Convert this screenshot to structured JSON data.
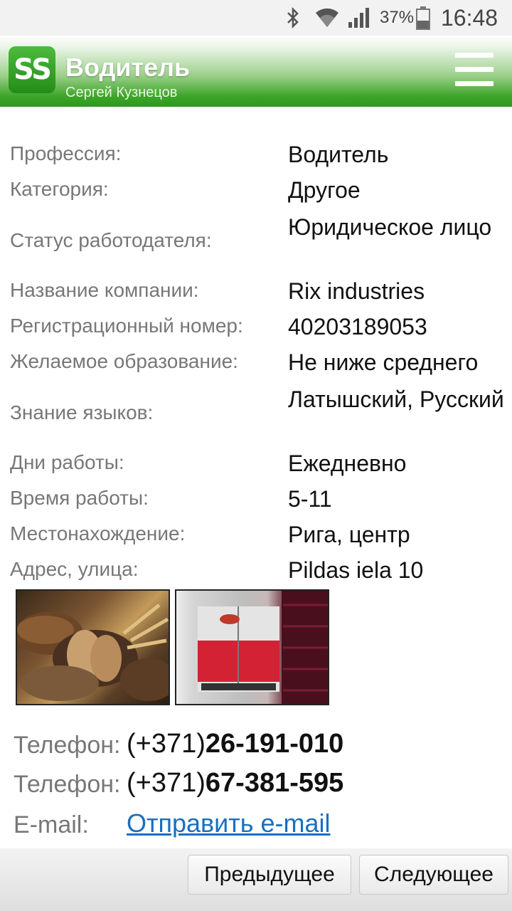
{
  "status_bar": {
    "battery_percent": "37%",
    "time": "16:48",
    "icons": [
      "bluetooth-icon",
      "wifi-icon",
      "signal-icon",
      "battery-icon"
    ]
  },
  "header": {
    "logo_text": "SS",
    "title": "Водитель",
    "subtitle": "Сергей Кузнецов",
    "menu_icon": "hamburger-menu-icon"
  },
  "details": [
    {
      "label": "Профессия:",
      "value": "Водитель"
    },
    {
      "label": "Категория:",
      "value": "Другое"
    },
    {
      "label": "Статус работодателя:",
      "value": "Юридическое лицо"
    },
    {
      "label": "Название компании:",
      "value": "Rix industries"
    },
    {
      "label": "Регистрационный номер:",
      "value": "40203189053"
    },
    {
      "label": "Желаемое образование:",
      "value": "Не ниже среднего"
    },
    {
      "label": "Знание языков:",
      "value": "Латышский, Русский"
    },
    {
      "label": "Дни работы:",
      "value": "Ежедневно"
    },
    {
      "label": "Время работы:",
      "value": "5-11"
    },
    {
      "label": "Местонахождение:",
      "value": "Рига, центр"
    },
    {
      "label": "Адрес, улица:",
      "value": "Pildas iela 10"
    }
  ],
  "photos": [
    "bread-photo",
    "delivery-truck-photo"
  ],
  "contacts": {
    "phone_label": "Телефон:",
    "phones": [
      {
        "prefix": "(+371)",
        "number": "26-191-010"
      },
      {
        "prefix": "(+371)",
        "number": "67-381-595"
      }
    ],
    "email_label": "E-mail:",
    "email_link": "Отправить e-mail"
  },
  "nav": {
    "prev_label": "Предыдущее",
    "next_label": "Следующее"
  },
  "colors": {
    "header_green": "#2a9a1c",
    "link_blue": "#1a6fc0",
    "label_gray": "#777777"
  }
}
